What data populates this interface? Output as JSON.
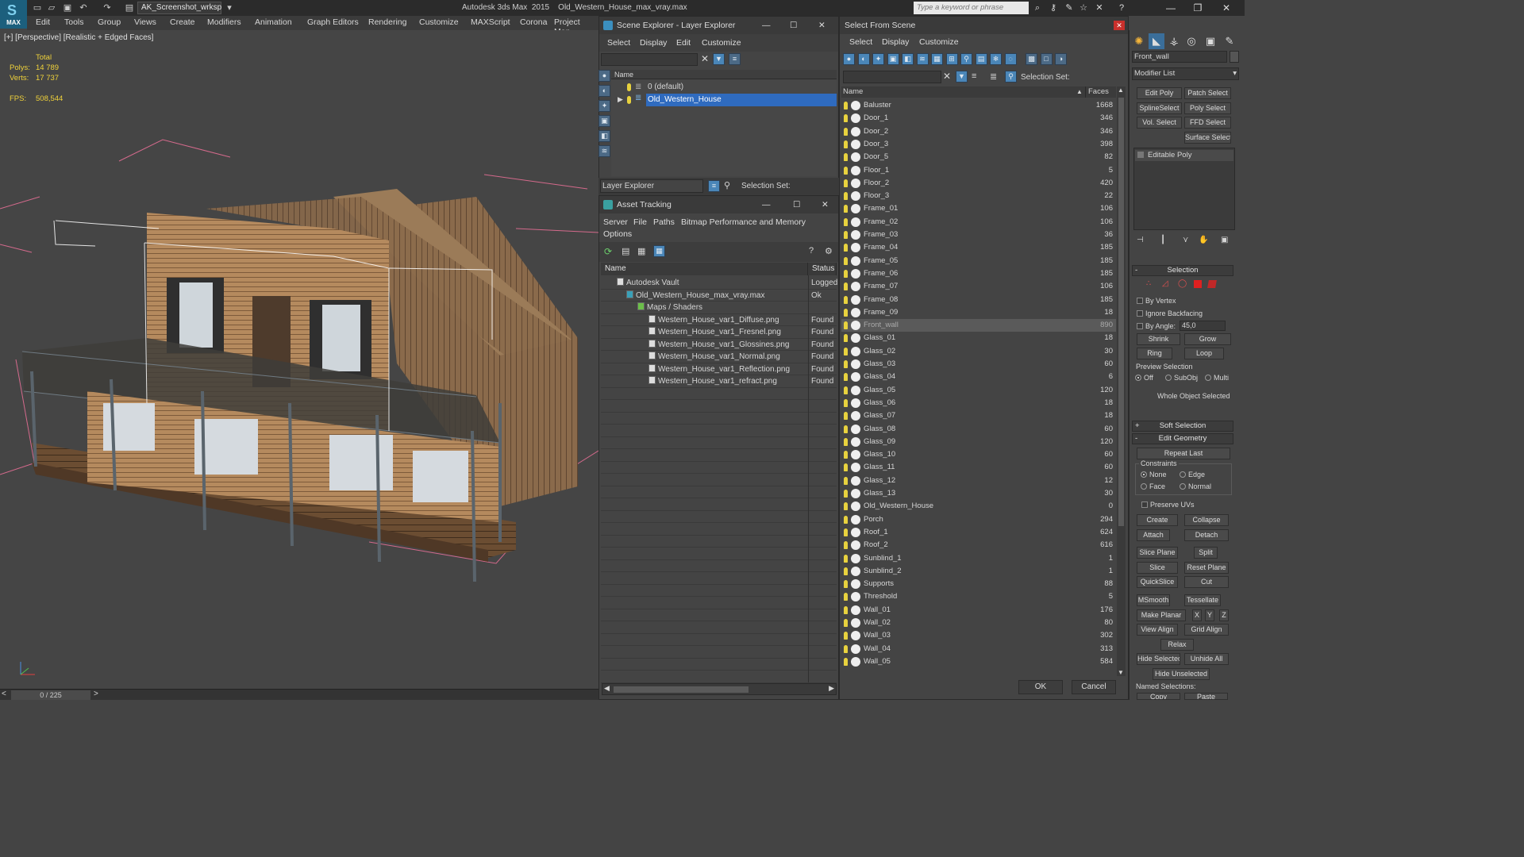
{
  "titlebar": {
    "logo_label": "MAX",
    "workspace": "AK_Screenshot_wrksp",
    "app_title": "Autodesk 3ds Max  2015    Old_Western_House_max_vray.max",
    "search_placeholder": "Type a keyword or phrase"
  },
  "menubar": [
    "Edit",
    "Tools",
    "Group",
    "Views",
    "Create",
    "Modifiers",
    "Animation",
    "Graph Editors",
    "Rendering",
    "Customize",
    "MAXScript",
    "Corona",
    "Project Man"
  ],
  "viewport": {
    "label": "[+] [Perspective] [Realistic + Edged Faces]",
    "stats": {
      "total_label": "Total",
      "polys_label": "Polys:",
      "polys": "14 789",
      "verts_label": "Verts:",
      "verts": "17 737",
      "fps_label": "FPS:",
      "fps": "508,544"
    }
  },
  "timeline": {
    "frame": "0 / 225"
  },
  "scene_explorer": {
    "title": "Scene Explorer - Layer Explorer",
    "menus": [
      "Select",
      "Display",
      "Edit",
      "Customize"
    ],
    "column": "Name",
    "rows": [
      "0 (default)",
      "Old_Western_House"
    ],
    "explorer_type": "Layer Explorer",
    "selection_set_label": "Selection Set:"
  },
  "asset_tracking": {
    "title": "Asset Tracking",
    "menus": [
      "Server",
      "File",
      "Paths",
      "Bitmap Performance and Memory",
      "Options"
    ],
    "col_name": "Name",
    "col_status": "Status",
    "rows": [
      {
        "name": "Autodesk Vault",
        "status": "Logged"
      },
      {
        "name": "Old_Western_House_max_vray.max",
        "status": "Ok"
      },
      {
        "name": "Maps / Shaders",
        "status": ""
      },
      {
        "name": "Western_House_var1_Diffuse.png",
        "status": "Found"
      },
      {
        "name": "Western_House_var1_Fresnel.png",
        "status": "Found"
      },
      {
        "name": "Western_House_var1_Glossines.png",
        "status": "Found"
      },
      {
        "name": "Western_House_var1_Normal.png",
        "status": "Found"
      },
      {
        "name": "Western_House_var1_Reflection.png",
        "status": "Found"
      },
      {
        "name": "Western_House_var1_refract.png",
        "status": "Found"
      }
    ]
  },
  "select_from_scene": {
    "title": "Select From Scene",
    "menus": [
      "Select",
      "Display",
      "Customize"
    ],
    "selection_set_label": "Selection Set:",
    "col_name": "Name",
    "col_faces": "Faces",
    "ok": "OK",
    "cancel": "Cancel",
    "selected": "Front_wall",
    "rows": [
      {
        "name": "Baluster",
        "faces": "1668"
      },
      {
        "name": "Door_1",
        "faces": "346"
      },
      {
        "name": "Door_2",
        "faces": "346"
      },
      {
        "name": "Door_3",
        "faces": "398"
      },
      {
        "name": "Door_5",
        "faces": "82"
      },
      {
        "name": "Floor_1",
        "faces": "5"
      },
      {
        "name": "Floor_2",
        "faces": "420"
      },
      {
        "name": "Floor_3",
        "faces": "22"
      },
      {
        "name": "Frame_01",
        "faces": "106"
      },
      {
        "name": "Frame_02",
        "faces": "106"
      },
      {
        "name": "Frame_03",
        "faces": "36"
      },
      {
        "name": "Frame_04",
        "faces": "185"
      },
      {
        "name": "Frame_05",
        "faces": "185"
      },
      {
        "name": "Frame_06",
        "faces": "185"
      },
      {
        "name": "Frame_07",
        "faces": "106"
      },
      {
        "name": "Frame_08",
        "faces": "185"
      },
      {
        "name": "Frame_09",
        "faces": "18"
      },
      {
        "name": "Front_wall",
        "faces": "890"
      },
      {
        "name": "Glass_01",
        "faces": "18"
      },
      {
        "name": "Glass_02",
        "faces": "30"
      },
      {
        "name": "Glass_03",
        "faces": "60"
      },
      {
        "name": "Glass_04",
        "faces": "6"
      },
      {
        "name": "Glass_05",
        "faces": "120"
      },
      {
        "name": "Glass_06",
        "faces": "18"
      },
      {
        "name": "Glass_07",
        "faces": "18"
      },
      {
        "name": "Glass_08",
        "faces": "60"
      },
      {
        "name": "Glass_09",
        "faces": "120"
      },
      {
        "name": "Glass_10",
        "faces": "60"
      },
      {
        "name": "Glass_11",
        "faces": "60"
      },
      {
        "name": "Glass_12",
        "faces": "12"
      },
      {
        "name": "Glass_13",
        "faces": "30"
      },
      {
        "name": "Old_Western_House",
        "faces": "0"
      },
      {
        "name": "Porch",
        "faces": "294"
      },
      {
        "name": "Roof_1",
        "faces": "624"
      },
      {
        "name": "Roof_2",
        "faces": "616"
      },
      {
        "name": "Sunblind_1",
        "faces": "1"
      },
      {
        "name": "Sunblind_2",
        "faces": "1"
      },
      {
        "name": "Supports",
        "faces": "88"
      },
      {
        "name": "Threshold",
        "faces": "5"
      },
      {
        "name": "Wall_01",
        "faces": "176"
      },
      {
        "name": "Wall_02",
        "faces": "80"
      },
      {
        "name": "Wall_03",
        "faces": "302"
      },
      {
        "name": "Wall_04",
        "faces": "313"
      },
      {
        "name": "Wall_05",
        "faces": "584"
      }
    ]
  },
  "command_panel": {
    "object_name": "Front_wall",
    "modifier_list": "Modifier List",
    "modifier_buttons": [
      "Edit Poly",
      "Patch Select",
      "SplineSelect",
      "Poly Select",
      "Vol. Select",
      "FFD Select",
      "Surface Select"
    ],
    "stack_item": "Editable Poly",
    "selection": {
      "header": "Selection",
      "by_vertex": "By Vertex",
      "ignore_backfacing": "Ignore Backfacing",
      "by_angle": "By Angle:",
      "angle_value": "45,0",
      "shrink": "Shrink",
      "grow": "Grow",
      "ring": "Ring",
      "loop": "Loop",
      "preview_selection": "Preview Selection",
      "preview_options": [
        "Off",
        "SubObj",
        "Multi"
      ],
      "whole_object": "Whole Object Selected"
    },
    "soft_selection": "Soft Selection",
    "edit_geometry": {
      "header": "Edit Geometry",
      "repeat_last": "Repeat Last",
      "constraints": "Constraints",
      "constraint_options": [
        "None",
        "Edge",
        "Face",
        "Normal"
      ],
      "preserve_uvs": "Preserve UVs",
      "buttons": [
        "Create",
        "Collapse",
        "Attach",
        "Detach",
        "Slice Plane",
        "Split",
        "Slice",
        "Reset Plane",
        "QuickSlice",
        "Cut",
        "MSmooth",
        "Tessellate",
        "Make Planar",
        "X",
        "Y",
        "Z",
        "View Align",
        "Grid Align",
        "Relax",
        "Hide Selected",
        "Unhide All",
        "Hide Unselected"
      ],
      "named_selections": "Named Selections:",
      "copy": "Copy",
      "paste": "Paste"
    }
  }
}
